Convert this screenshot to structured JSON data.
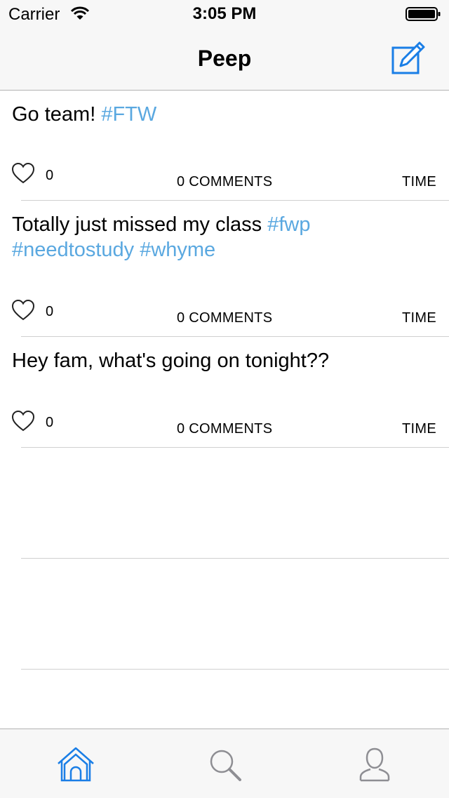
{
  "status": {
    "carrier": "Carrier",
    "time": "3:05 PM"
  },
  "nav": {
    "title": "Peep"
  },
  "colors": {
    "accent": "#1a7ee6",
    "hashtag": "#5aa8e0"
  },
  "posts": [
    {
      "text": "Go team! ",
      "tags": "#FTW",
      "likes": "0",
      "comments": "0 COMMENTS",
      "time": "TIME"
    },
    {
      "text": "Totally just missed my class ",
      "tags": "#fwp #needtostudy #whyme",
      "likes": "0",
      "comments": "0 COMMENTS",
      "time": "TIME"
    },
    {
      "text": "Hey fam, what's going on tonight??",
      "tags": "",
      "likes": "0",
      "comments": "0 COMMENTS",
      "time": "TIME"
    }
  ],
  "tabs": [
    "home-icon",
    "search-icon",
    "profile-icon"
  ]
}
